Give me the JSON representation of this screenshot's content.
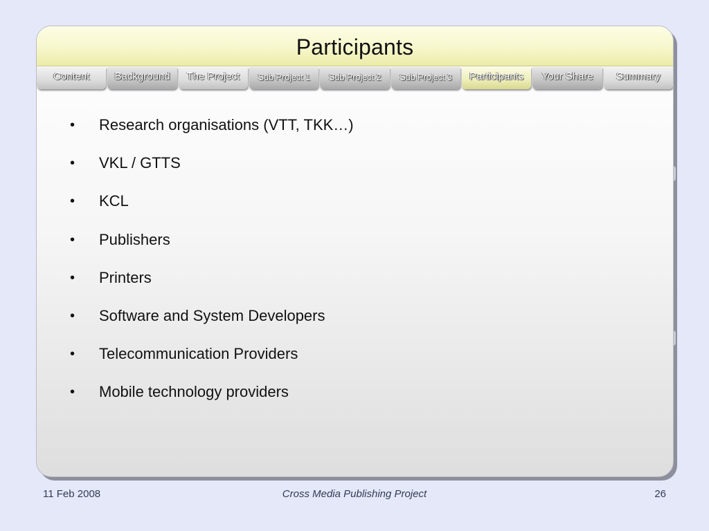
{
  "slide": {
    "title": "Participants",
    "tabs": [
      {
        "label": "Content"
      },
      {
        "label": "Background"
      },
      {
        "label": "The Project"
      },
      {
        "label": "Sub Project 1"
      },
      {
        "label": "Sub Project 2"
      },
      {
        "label": "Sub Project 3"
      },
      {
        "label": "Participants"
      },
      {
        "label": "Your Share"
      },
      {
        "label": "Summary"
      }
    ],
    "active_tab": "Participants",
    "bullet_glyph": "•",
    "bullets": [
      "Research organisations (VTT, TKK…)",
      "VKL / GTTS",
      "KCL",
      "Publishers",
      "Printers",
      "Software and System Developers",
      "Telecommunication Providers",
      "Mobile technology providers"
    ]
  },
  "footer": {
    "date": "11 Feb 2008",
    "project": "Cross Media Publishing Project",
    "page_number": "26"
  },
  "colors": {
    "background": "#e4e8f8",
    "title_bar": "#f7f7cc",
    "active_tab": "#efefbd",
    "tab": "#c8c8c8",
    "footer_text": "#333a55"
  }
}
